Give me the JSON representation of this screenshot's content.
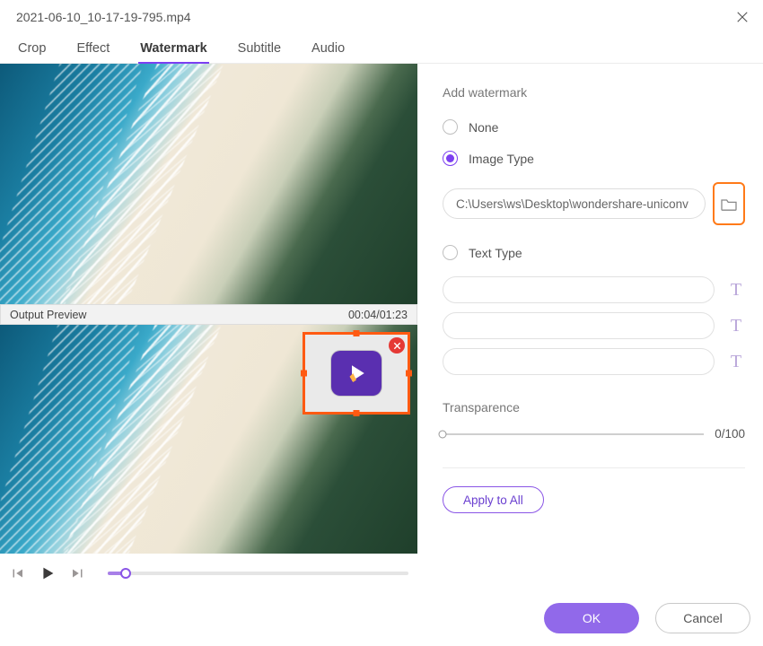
{
  "window": {
    "title": "2021-06-10_10-17-19-795.mp4"
  },
  "tabs": {
    "items": [
      {
        "label": "Crop"
      },
      {
        "label": "Effect"
      },
      {
        "label": "Watermark"
      },
      {
        "label": "Subtitle"
      },
      {
        "label": "Audio"
      }
    ],
    "active_index": 2
  },
  "preview": {
    "output_label": "Output Preview",
    "timestamp": "00:04/01:23"
  },
  "panel": {
    "section_title": "Add watermark",
    "options": {
      "none_label": "None",
      "image_label": "Image Type",
      "text_label": "Text Type",
      "selected": "image"
    },
    "image_path": "C:\\Users\\ws\\Desktop\\wondershare-uniconv",
    "transparence": {
      "label": "Transparence",
      "value_text": "0/100",
      "value": 0,
      "max": 100
    },
    "apply_all_label": "Apply to All"
  },
  "footer": {
    "ok_label": "OK",
    "cancel_label": "Cancel"
  },
  "colors": {
    "accent": "#7c3ff0",
    "highlight_orange": "#ff5a12"
  }
}
